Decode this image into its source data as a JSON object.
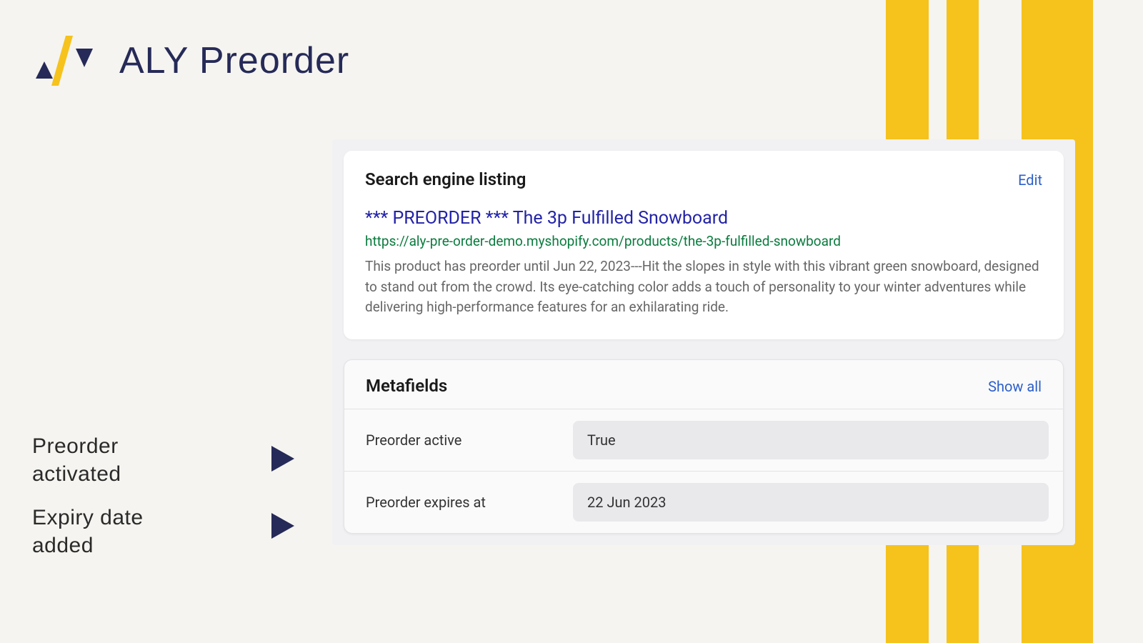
{
  "app": {
    "name": "ALY Preorder"
  },
  "captions": {
    "activated": "Preorder\nactivated",
    "expiry": "Expiry date\nadded"
  },
  "search_card": {
    "heading": "Search engine listing",
    "edit_label": "Edit",
    "title": "*** PREORDER *** The 3p Fulfilled Snowboard",
    "url": "https://aly-pre-order-demo.myshopify.com/products/the-3p-fulfilled-snowboard",
    "description": "This product has preorder until Jun 22, 2023---Hit the slopes in style with this vibrant green snowboard, designed to stand out from the crowd. Its eye-catching color adds a touch of personality to your winter adventures while delivering high-performance features for an exhilarating ride."
  },
  "metafields_card": {
    "heading": "Metafields",
    "show_all_label": "Show all",
    "rows": [
      {
        "label": "Preorder active",
        "value": "True"
      },
      {
        "label": "Preorder expires at",
        "value": "22 Jun 2023"
      }
    ]
  }
}
